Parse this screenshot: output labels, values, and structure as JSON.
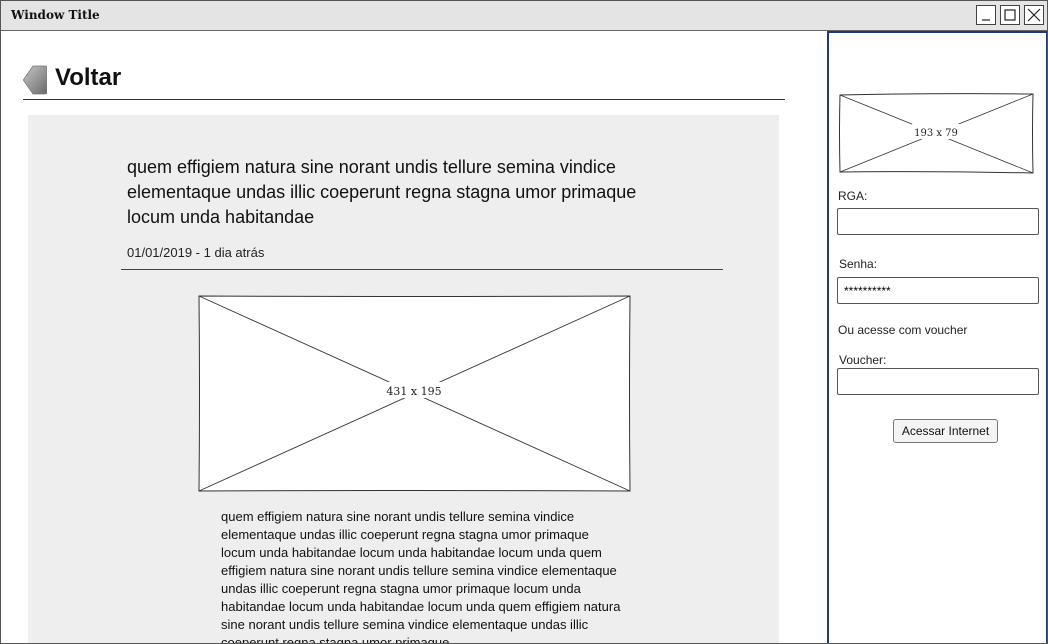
{
  "window": {
    "title": "Window Title",
    "controls": [
      "minimize-icon",
      "maximize-icon",
      "close-icon"
    ]
  },
  "header": {
    "back_label": "Voltar",
    "back_icon": "back-arrow-icon"
  },
  "article": {
    "title": "quem effigiem natura sine norant undis tellure semina vindice elementaque undas illic coeperunt regna stagna umor primaque locum unda habitandae",
    "date": "01/01/2019 - 1 dia atrás",
    "image_placeholder": "431 x 195",
    "body": "quem effigiem natura sine norant undis tellure semina vindice elementaque undas illic coeperunt regna stagna umor primaque locum unda habitandae locum unda habitandae locum unda quem effigiem natura sine norant undis tellure semina vindice elementaque undas illic coeperunt regna stagna umor primaque locum unda habitandae locum unda habitandae locum unda quem effigiem natura sine norant undis tellure semina vindice elementaque undas illic coeperunt regna stagna umor primaque"
  },
  "login": {
    "logo_placeholder": "193 x 79",
    "rga_label": "RGA:",
    "rga_value": "",
    "password_label": "Senha:",
    "password_value": "**********",
    "voucher_note": "Ou acesse com voucher",
    "voucher_label": "Voucher:",
    "voucher_value": "",
    "submit_label": "Acessar Internet"
  },
  "colors": {
    "titlebar": "#e4e4e4",
    "article_background": "#eeeeee",
    "sidebar_border": "#1f3a78"
  }
}
